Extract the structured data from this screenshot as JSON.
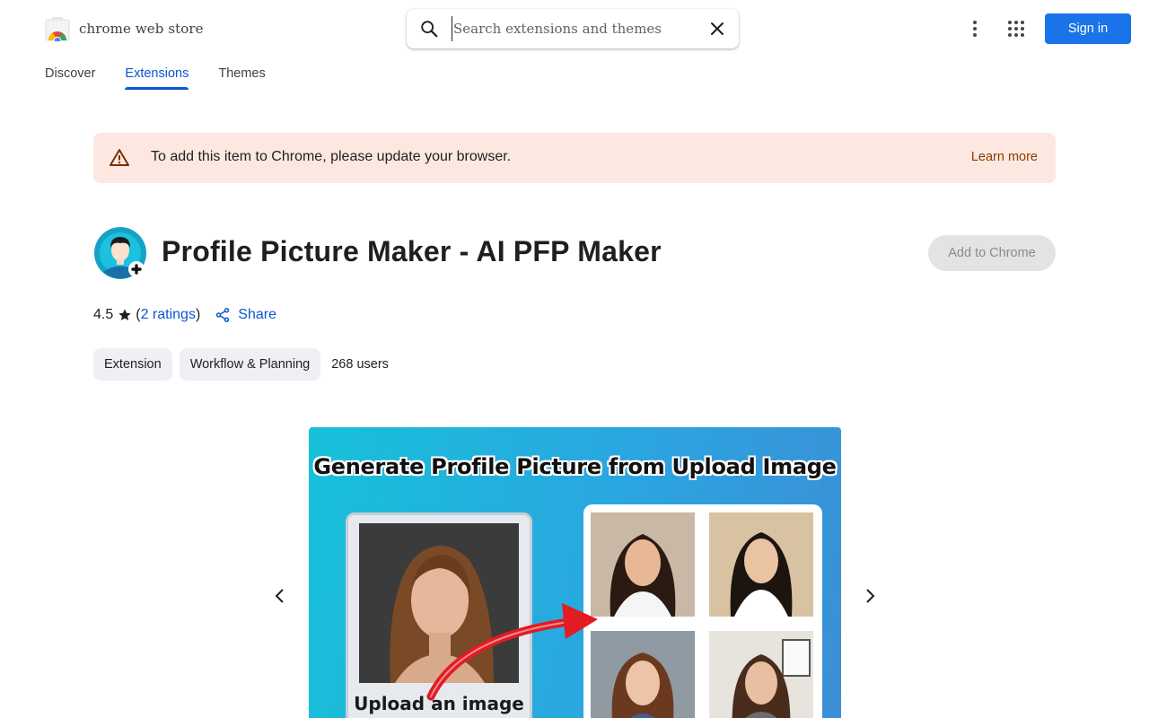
{
  "header": {
    "logo_text": "chrome web store",
    "search_placeholder": "Search extensions and themes",
    "signin_label": "Sign in"
  },
  "nav": {
    "tabs": [
      {
        "label": "Discover",
        "active": false
      },
      {
        "label": "Extensions",
        "active": true
      },
      {
        "label": "Themes",
        "active": false
      }
    ]
  },
  "banner": {
    "message": "To add this item to Chrome, please update your browser.",
    "link": "Learn more"
  },
  "extension": {
    "title": "Profile Picture Maker - AI PFP Maker",
    "add_button": "Add to Chrome",
    "rating": "4.5",
    "ratings_open": "(",
    "ratings_link": "2 ratings",
    "ratings_close": ")",
    "share_label": "Share",
    "chips": [
      "Extension",
      "Workflow & Planning"
    ],
    "users": "268 users"
  },
  "carousel": {
    "slide_title": "Generate Profile Picture from Upload Image",
    "upload_label": "Upload an image"
  },
  "colors": {
    "accent": "#0b57d0",
    "signin": "#1a73e8",
    "banner_bg": "#fce8e1",
    "banner_link": "#8c3b00"
  }
}
